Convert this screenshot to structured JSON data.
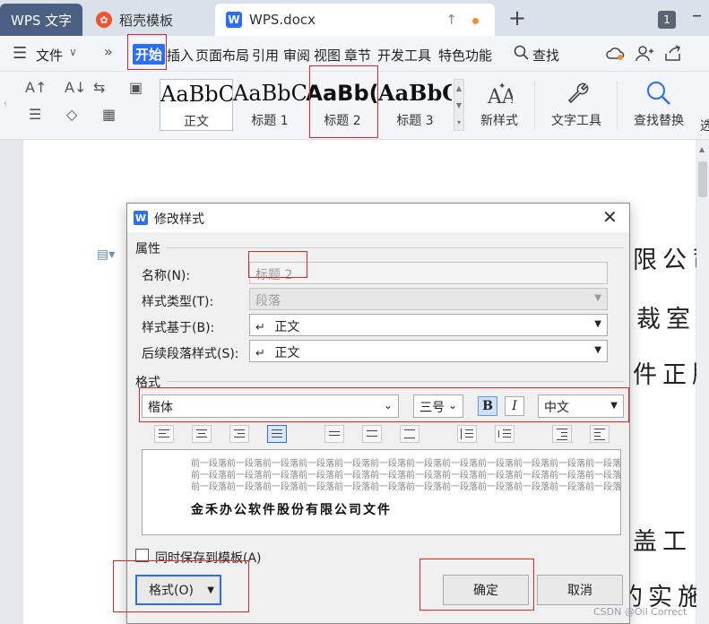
{
  "tabs": {
    "home": "WPS 文字",
    "template": "稻壳模板",
    "template_logo": "✿",
    "doc": "WPS.docx",
    "doc_logo": "W",
    "window_count": "1"
  },
  "menu": {
    "file": "文件",
    "start": "开始",
    "items": [
      "插入",
      "页面布局",
      "引用",
      "审阅",
      "视图",
      "章节",
      "开发工具",
      "特色功能"
    ],
    "search": "查找"
  },
  "ribbon": {
    "styles": [
      {
        "sample": "AaBbC",
        "label": "正文"
      },
      {
        "sample": "AaBbC",
        "label": "标题 1"
      },
      {
        "sample": "AaBb(",
        "label": "标题 2"
      },
      {
        "sample": "AaBbC",
        "label": "标题 3"
      }
    ],
    "new_style": "新样式",
    "text_tools": "文字工具",
    "find_replace": "查找替换",
    "select": "选"
  },
  "document": {
    "lines": [
      "限公司",
      "裁室",
      "件正版",
      "盖工",
      "的实施"
    ]
  },
  "dialog": {
    "title": "修改样式",
    "title_logo": "W",
    "section_properties": "属性",
    "name_label": "名称(N):",
    "name_value": "标题 2",
    "type_label": "样式类型(T):",
    "type_value": "段落",
    "based_label": "样式基于(B):",
    "based_value": "正文",
    "next_label": "后续段落样式(S):",
    "next_value": "正文",
    "section_format": "格式",
    "font": "楷体",
    "size": "三号",
    "bold": "B",
    "italic": "I",
    "language": "中文",
    "preview_prev_line": "前一段落前一段落前一段落前一段落前一段落前一段落前一段落前一段落前一段落前一段落前一段落前一段落前一段落前一段落前一段落前一段落",
    "preview_sample": "金禾办公软件股份有限公司文件",
    "save_template": "同时保存到模板(A)",
    "format_button": "格式(O)",
    "ok": "确定",
    "cancel": "取消"
  },
  "watermark": "CSDN @Oil Correct",
  "colors": {
    "accent": "#2a6ef5",
    "highlight_box": "#e0262b",
    "home_tab": "#4a5f81"
  }
}
